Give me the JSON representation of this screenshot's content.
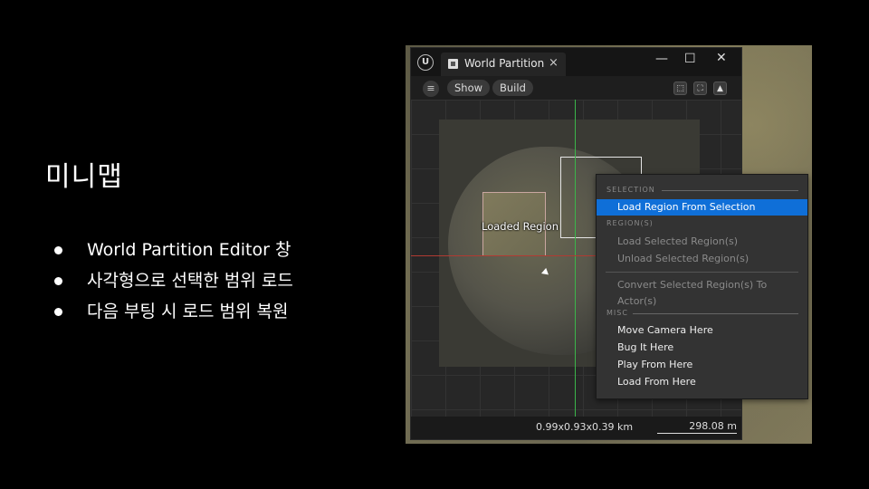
{
  "slide": {
    "title": "미니맵",
    "bullets": [
      "World Partition Editor 창",
      "사각형으로 선택한 범위 로드",
      "다음 부팅 시 로드 범위 복원"
    ]
  },
  "window": {
    "logo": "U",
    "tab_title": "World Partition",
    "tab_close": "×",
    "minimize": "—",
    "maximize": "☐",
    "close": "✕",
    "menu_icon": "≡"
  },
  "toolbar": {
    "show_label": "Show",
    "build_label": "Build",
    "tool_icons": [
      "select-icon",
      "zoom-extent-icon",
      "terrain-icon"
    ]
  },
  "viewport": {
    "loaded_region_label": "Loaded Region",
    "dimensions": "0.99x0.93x0.39 km",
    "scale": "298.08 m"
  },
  "context_menu": {
    "selection_header": "SELECTION",
    "load_region_from_selection": "Load Region From Selection",
    "regions_header": "REGION(S)",
    "load_selected_regions": "Load Selected Region(s)",
    "unload_selected_regions": "Unload Selected Region(s)",
    "convert_selected_regions": "Convert Selected Region(s) To Actor(s)",
    "misc_header": "MISC",
    "move_camera_here": "Move Camera Here",
    "bug_it_here": "Bug It Here",
    "play_from_here": "Play From Here",
    "load_from_here": "Load From Here"
  },
  "colors": {
    "highlight": "#0f6fd8",
    "x_axis": "#b13a32",
    "y_axis": "#3bb54a"
  }
}
